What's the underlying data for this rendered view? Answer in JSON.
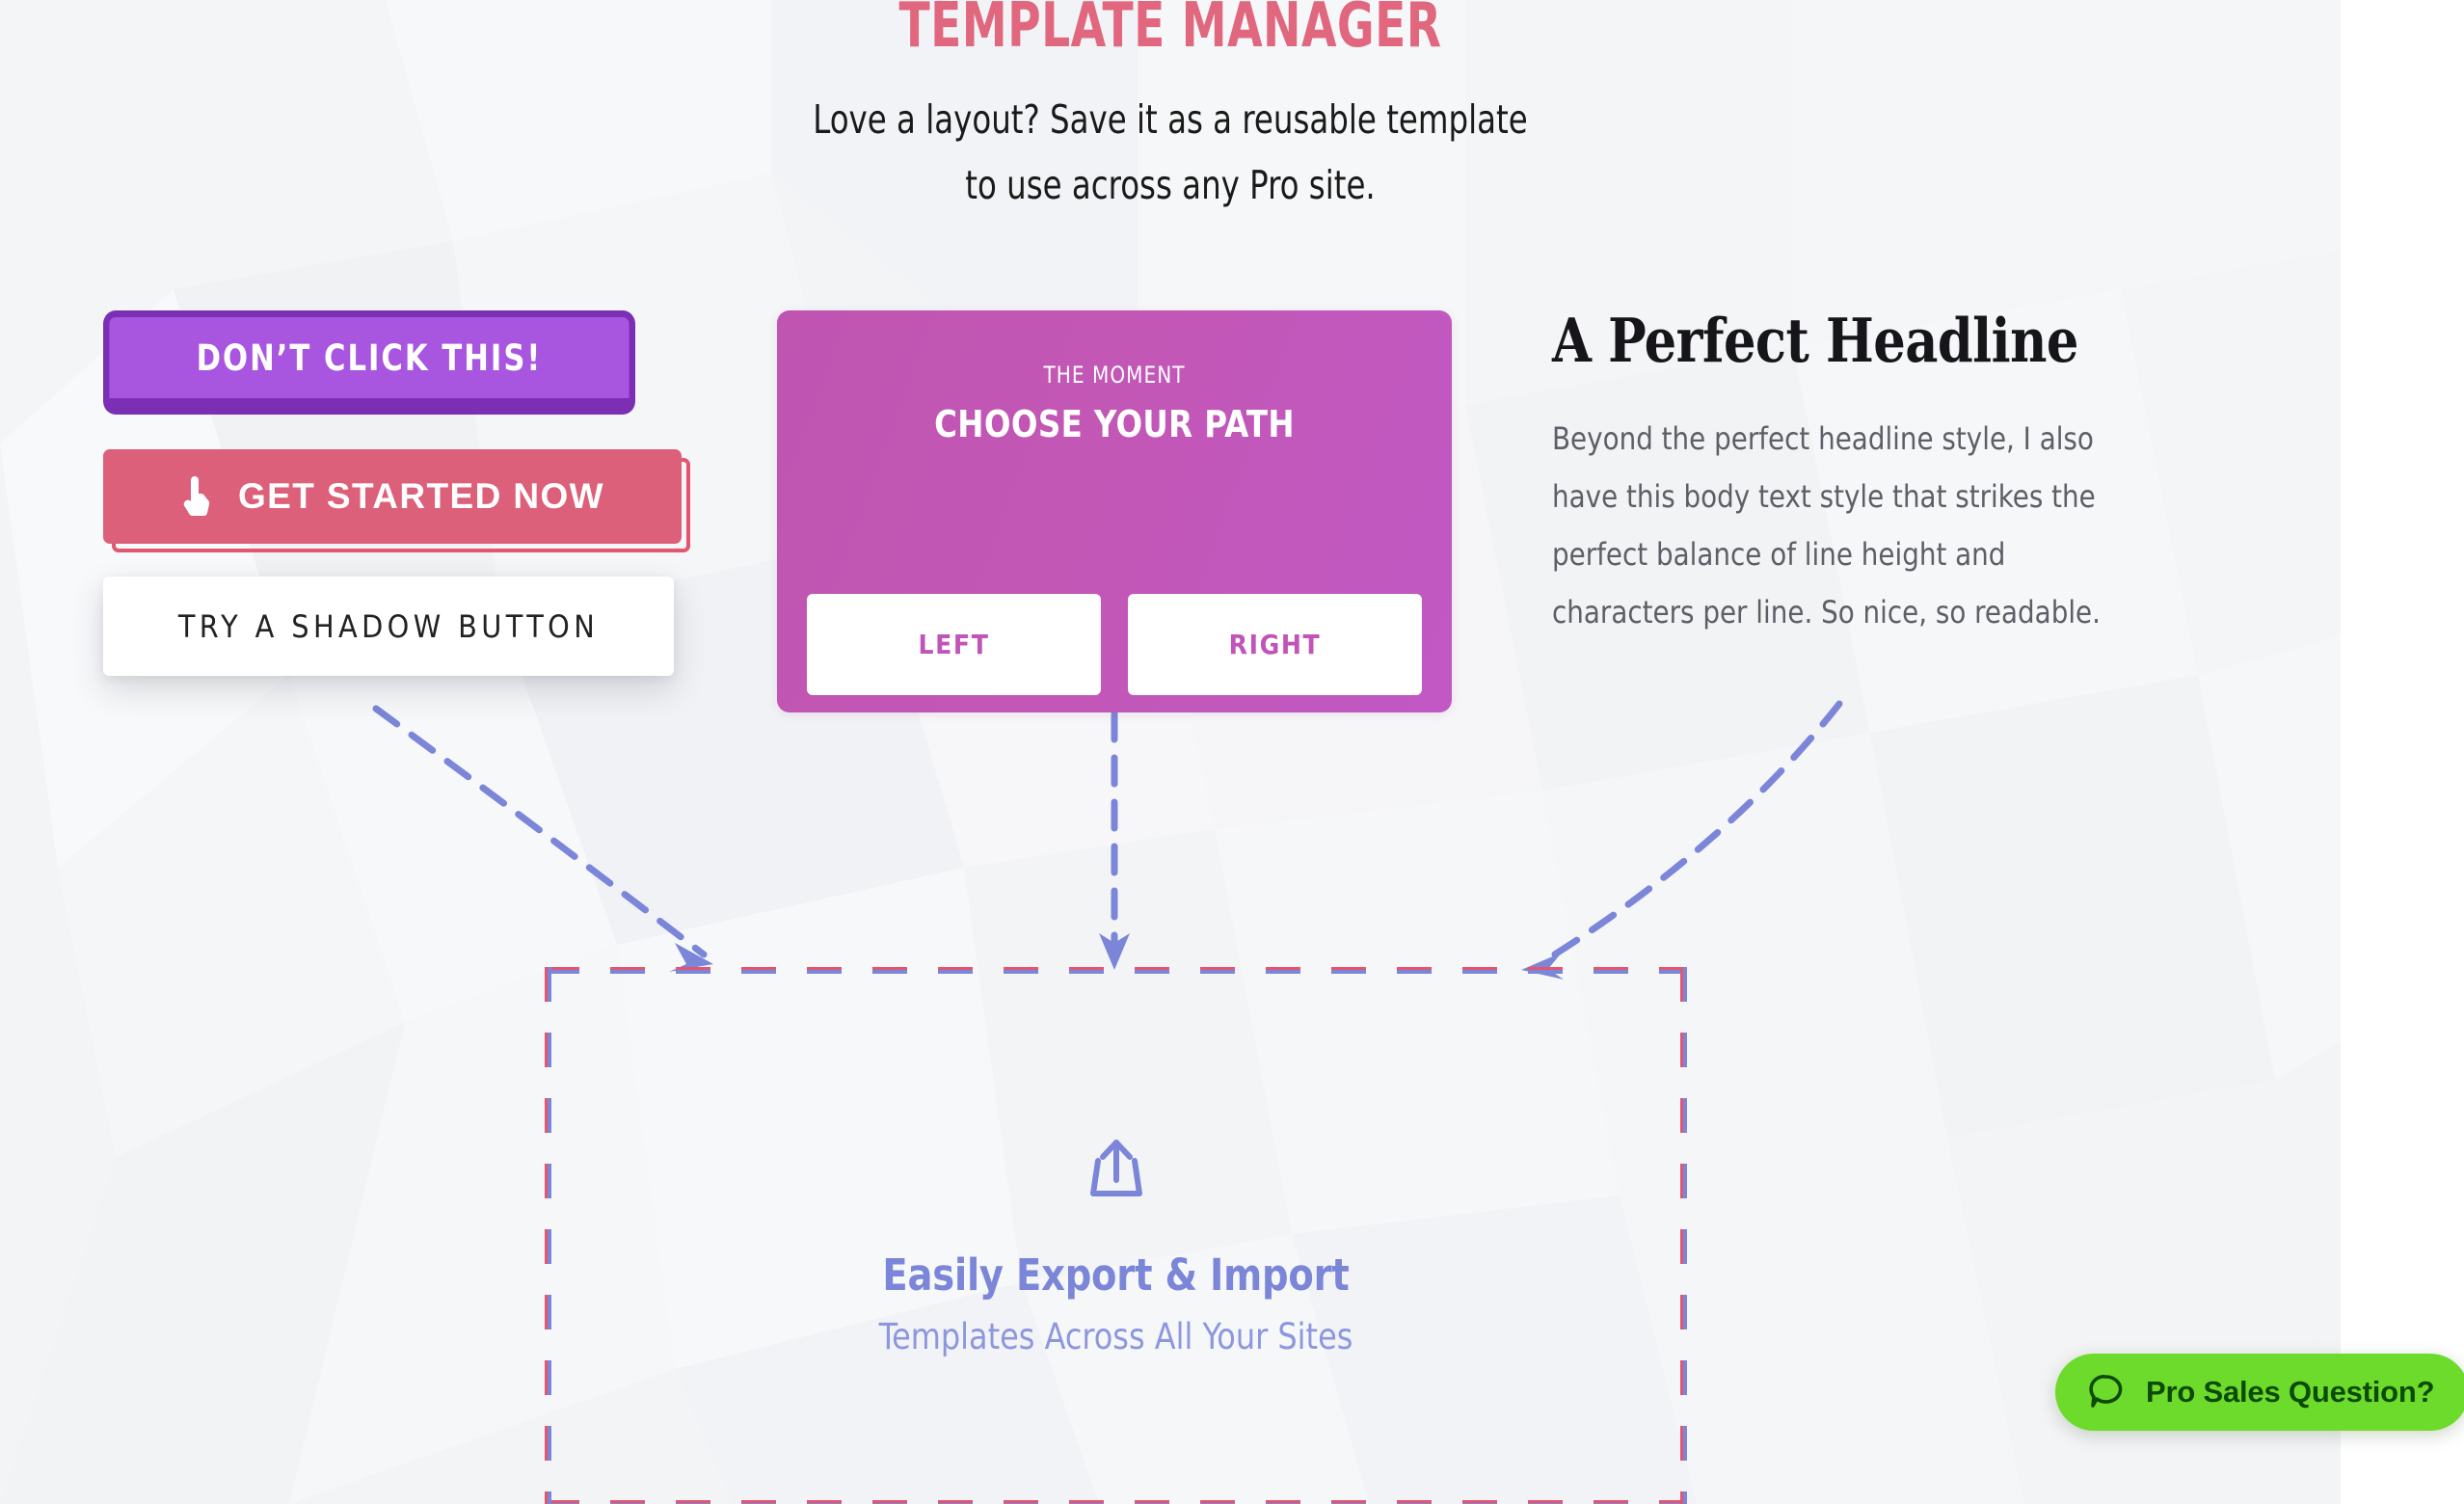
{
  "header": {
    "title": "TEMPLATE MANAGER",
    "subtitle_line1": "Love a layout? Save it as a reusable template",
    "subtitle_line2": "to use across any Pro site.",
    "title_color": "#e0677e"
  },
  "left_column": {
    "dont_click_label": "DON’T CLICK THIS!",
    "get_started_label": "GET STARTED NOW",
    "get_started_icon": "hand-pointing-up-icon",
    "shadow_button_label": "TRY A SHADOW BUTTON",
    "purple_color": "#a855e0",
    "purple_border_color": "#7b2fb5",
    "red_color": "#dd607a"
  },
  "center_card": {
    "eyebrow": "THE MOMENT",
    "title": "CHOOSE YOUR PATH",
    "choices": [
      {
        "label": "LEFT"
      },
      {
        "label": "RIGHT"
      }
    ],
    "gradient_from": "#c054b1",
    "gradient_to": "#c158c4",
    "choice_text_color": "#c054b8"
  },
  "right_column": {
    "headline": "A Perfect Headline",
    "body": "Beyond the perfect headline style, I also have this body text style that strikes the perfect balance of line height and characters per line. So nice, so readable.",
    "body_color": "#5e5e66"
  },
  "dropzone": {
    "icon": "upload-export-icon",
    "title": "Easily Export & Import",
    "subtitle": "Templates Across All Your Sites",
    "accent_color": "#7b86d8",
    "border_dash_colors": [
      "#e2566f",
      "#7b86d8"
    ]
  },
  "chat_widget": {
    "label": "Pro Sales Question?",
    "icon": "chat-bubble-icon",
    "background_color": "#6ddb2b",
    "text_color": "#0c4a05"
  }
}
